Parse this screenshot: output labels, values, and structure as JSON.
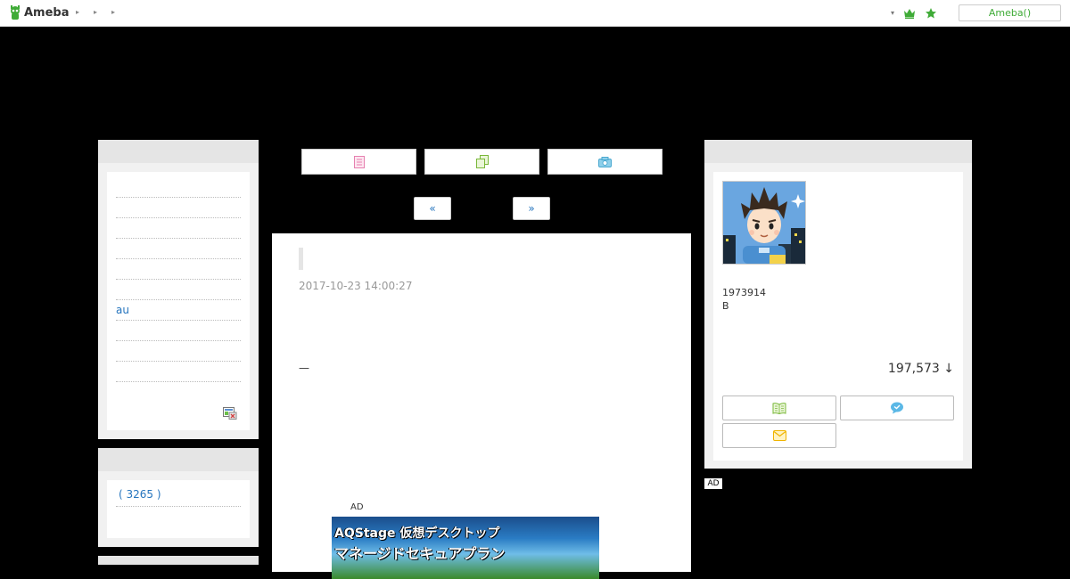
{
  "header": {
    "logo_text": "Ameba",
    "crumbs": [
      "▸",
      "▸",
      "▸"
    ],
    "dropdown_glyph": "▾",
    "login_label": "Ameba()",
    "accent": "#3fab37"
  },
  "nav_buttons": [
    {
      "icon": "list-icon"
    },
    {
      "icon": "copy-icon"
    },
    {
      "icon": "camera-icon"
    }
  ],
  "pager": {
    "prev": "«",
    "next": "»"
  },
  "sidebar": {
    "theme_rows": [
      "",
      "",
      "",
      "",
      "",
      "au",
      "",
      "",
      ""
    ],
    "archive_row": "( 3265 )"
  },
  "entry": {
    "date": "2017-10-23 14:00:27",
    "body_dash": "—",
    "ad_label": "AD",
    "ad_line1": "AQStage 仮想デスクトップ",
    "ad_line2": "マネージドセキュアプラン"
  },
  "profile": {
    "user_id": "1973914",
    "blood_type": "B",
    "reader_count": "197,573 ↓",
    "buttons": [
      {
        "icon": "book-icon"
      },
      {
        "icon": "message-icon"
      },
      {
        "icon": "mail-icon"
      }
    ]
  },
  "right_ad_label": "AD"
}
